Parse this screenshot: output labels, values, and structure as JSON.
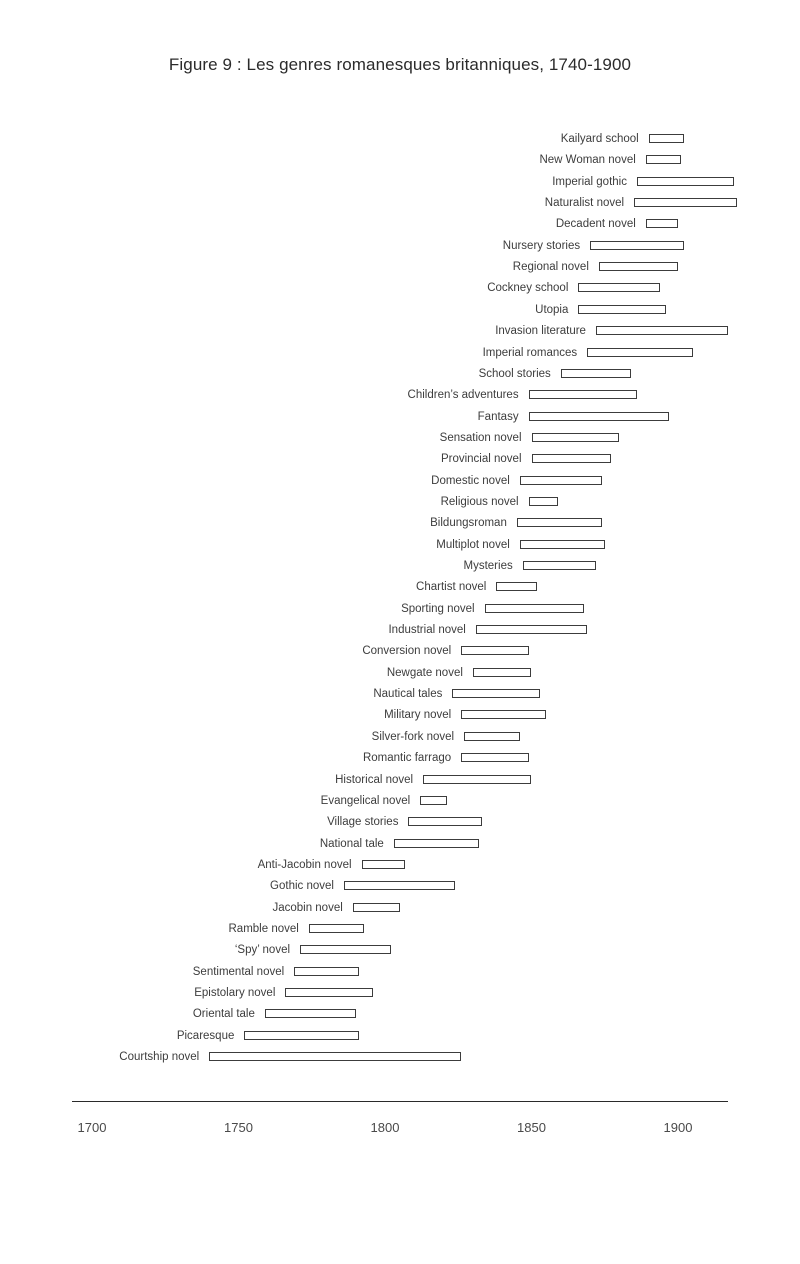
{
  "figure": {
    "title": "Figure 9 : Les genres romanesques britanniques, 1740-1900"
  },
  "axis": {
    "tick_labels": [
      "1700",
      "1750",
      "1800",
      "1850",
      "1900"
    ],
    "tick_values": [
      1700,
      1750,
      1800,
      1850,
      1900
    ]
  },
  "chart_data": {
    "type": "bar",
    "subtype": "horizontal-range-bars",
    "title": "Figure 9 : Les genres romanesques britanniques, 1740-1900",
    "xlabel": "",
    "ylabel": "",
    "xlim": [
      1692,
      1920
    ],
    "xticks": [
      1700,
      1750,
      1800,
      1850,
      1900
    ],
    "grid": false,
    "legend": null,
    "orientation": "horizontal",
    "bar_fill_color": "#ffffff",
    "bar_border_color": "#3c3c3c",
    "note": "Each bar spans the start and end year of a British novel genre. Rows listed top to bottom as drawn.",
    "categories": [
      "Kailyard school",
      "New Woman novel",
      "Imperial gothic",
      "Naturalist novel",
      "Decadent novel",
      "Nursery stories",
      "Regional novel",
      "Cockney school",
      "Utopia",
      "Invasion literature",
      "Imperial romances",
      "School stories",
      "Children’s adventures",
      "Fantasy",
      "Sensation novel",
      "Provincial novel",
      "Domestic novel",
      "Religious novel",
      "Bildungsroman",
      "Multiplot novel",
      "Mysteries",
      "Chartist novel",
      "Sporting novel",
      "Industrial novel",
      "Conversion novel",
      "Newgate novel",
      "Nautical tales",
      "Military novel",
      "Silver-fork novel",
      "Romantic farrago",
      "Historical novel",
      "Evangelical novel",
      "Village stories",
      "National tale",
      "Anti-Jacobin novel",
      "Gothic novel",
      "Jacobin novel",
      "Ramble novel",
      "‘Spy’ novel",
      "Sentimental novel",
      "Epistolary novel",
      "Oriental tale",
      "Picaresque",
      "Courtship novel"
    ],
    "ranges": [
      [
        1890,
        1902
      ],
      [
        1889,
        1901
      ],
      [
        1886,
        1919
      ],
      [
        1885,
        1920
      ],
      [
        1889,
        1900
      ],
      [
        1870,
        1902
      ],
      [
        1873,
        1900
      ],
      [
        1866,
        1894
      ],
      [
        1866,
        1896
      ],
      [
        1872,
        1917
      ],
      [
        1869,
        1905
      ],
      [
        1860,
        1884
      ],
      [
        1849,
        1886
      ],
      [
        1849,
        1897
      ],
      [
        1850,
        1880
      ],
      [
        1850,
        1877
      ],
      [
        1846,
        1874
      ],
      [
        1849,
        1859
      ],
      [
        1845,
        1874
      ],
      [
        1846,
        1875
      ],
      [
        1847,
        1872
      ],
      [
        1838,
        1852
      ],
      [
        1834,
        1868
      ],
      [
        1831,
        1869
      ],
      [
        1826,
        1849
      ],
      [
        1830,
        1850
      ],
      [
        1823,
        1853
      ],
      [
        1826,
        1855
      ],
      [
        1827,
        1846
      ],
      [
        1826,
        1849
      ],
      [
        1813,
        1850
      ],
      [
        1812,
        1821
      ],
      [
        1808,
        1833
      ],
      [
        1803,
        1832
      ],
      [
        1792,
        1807
      ],
      [
        1786,
        1824
      ],
      [
        1789,
        1805
      ],
      [
        1774,
        1793
      ],
      [
        1771,
        1802
      ],
      [
        1769,
        1791
      ],
      [
        1766,
        1796
      ],
      [
        1759,
        1790
      ],
      [
        1752,
        1791
      ],
      [
        1740,
        1826
      ]
    ]
  }
}
